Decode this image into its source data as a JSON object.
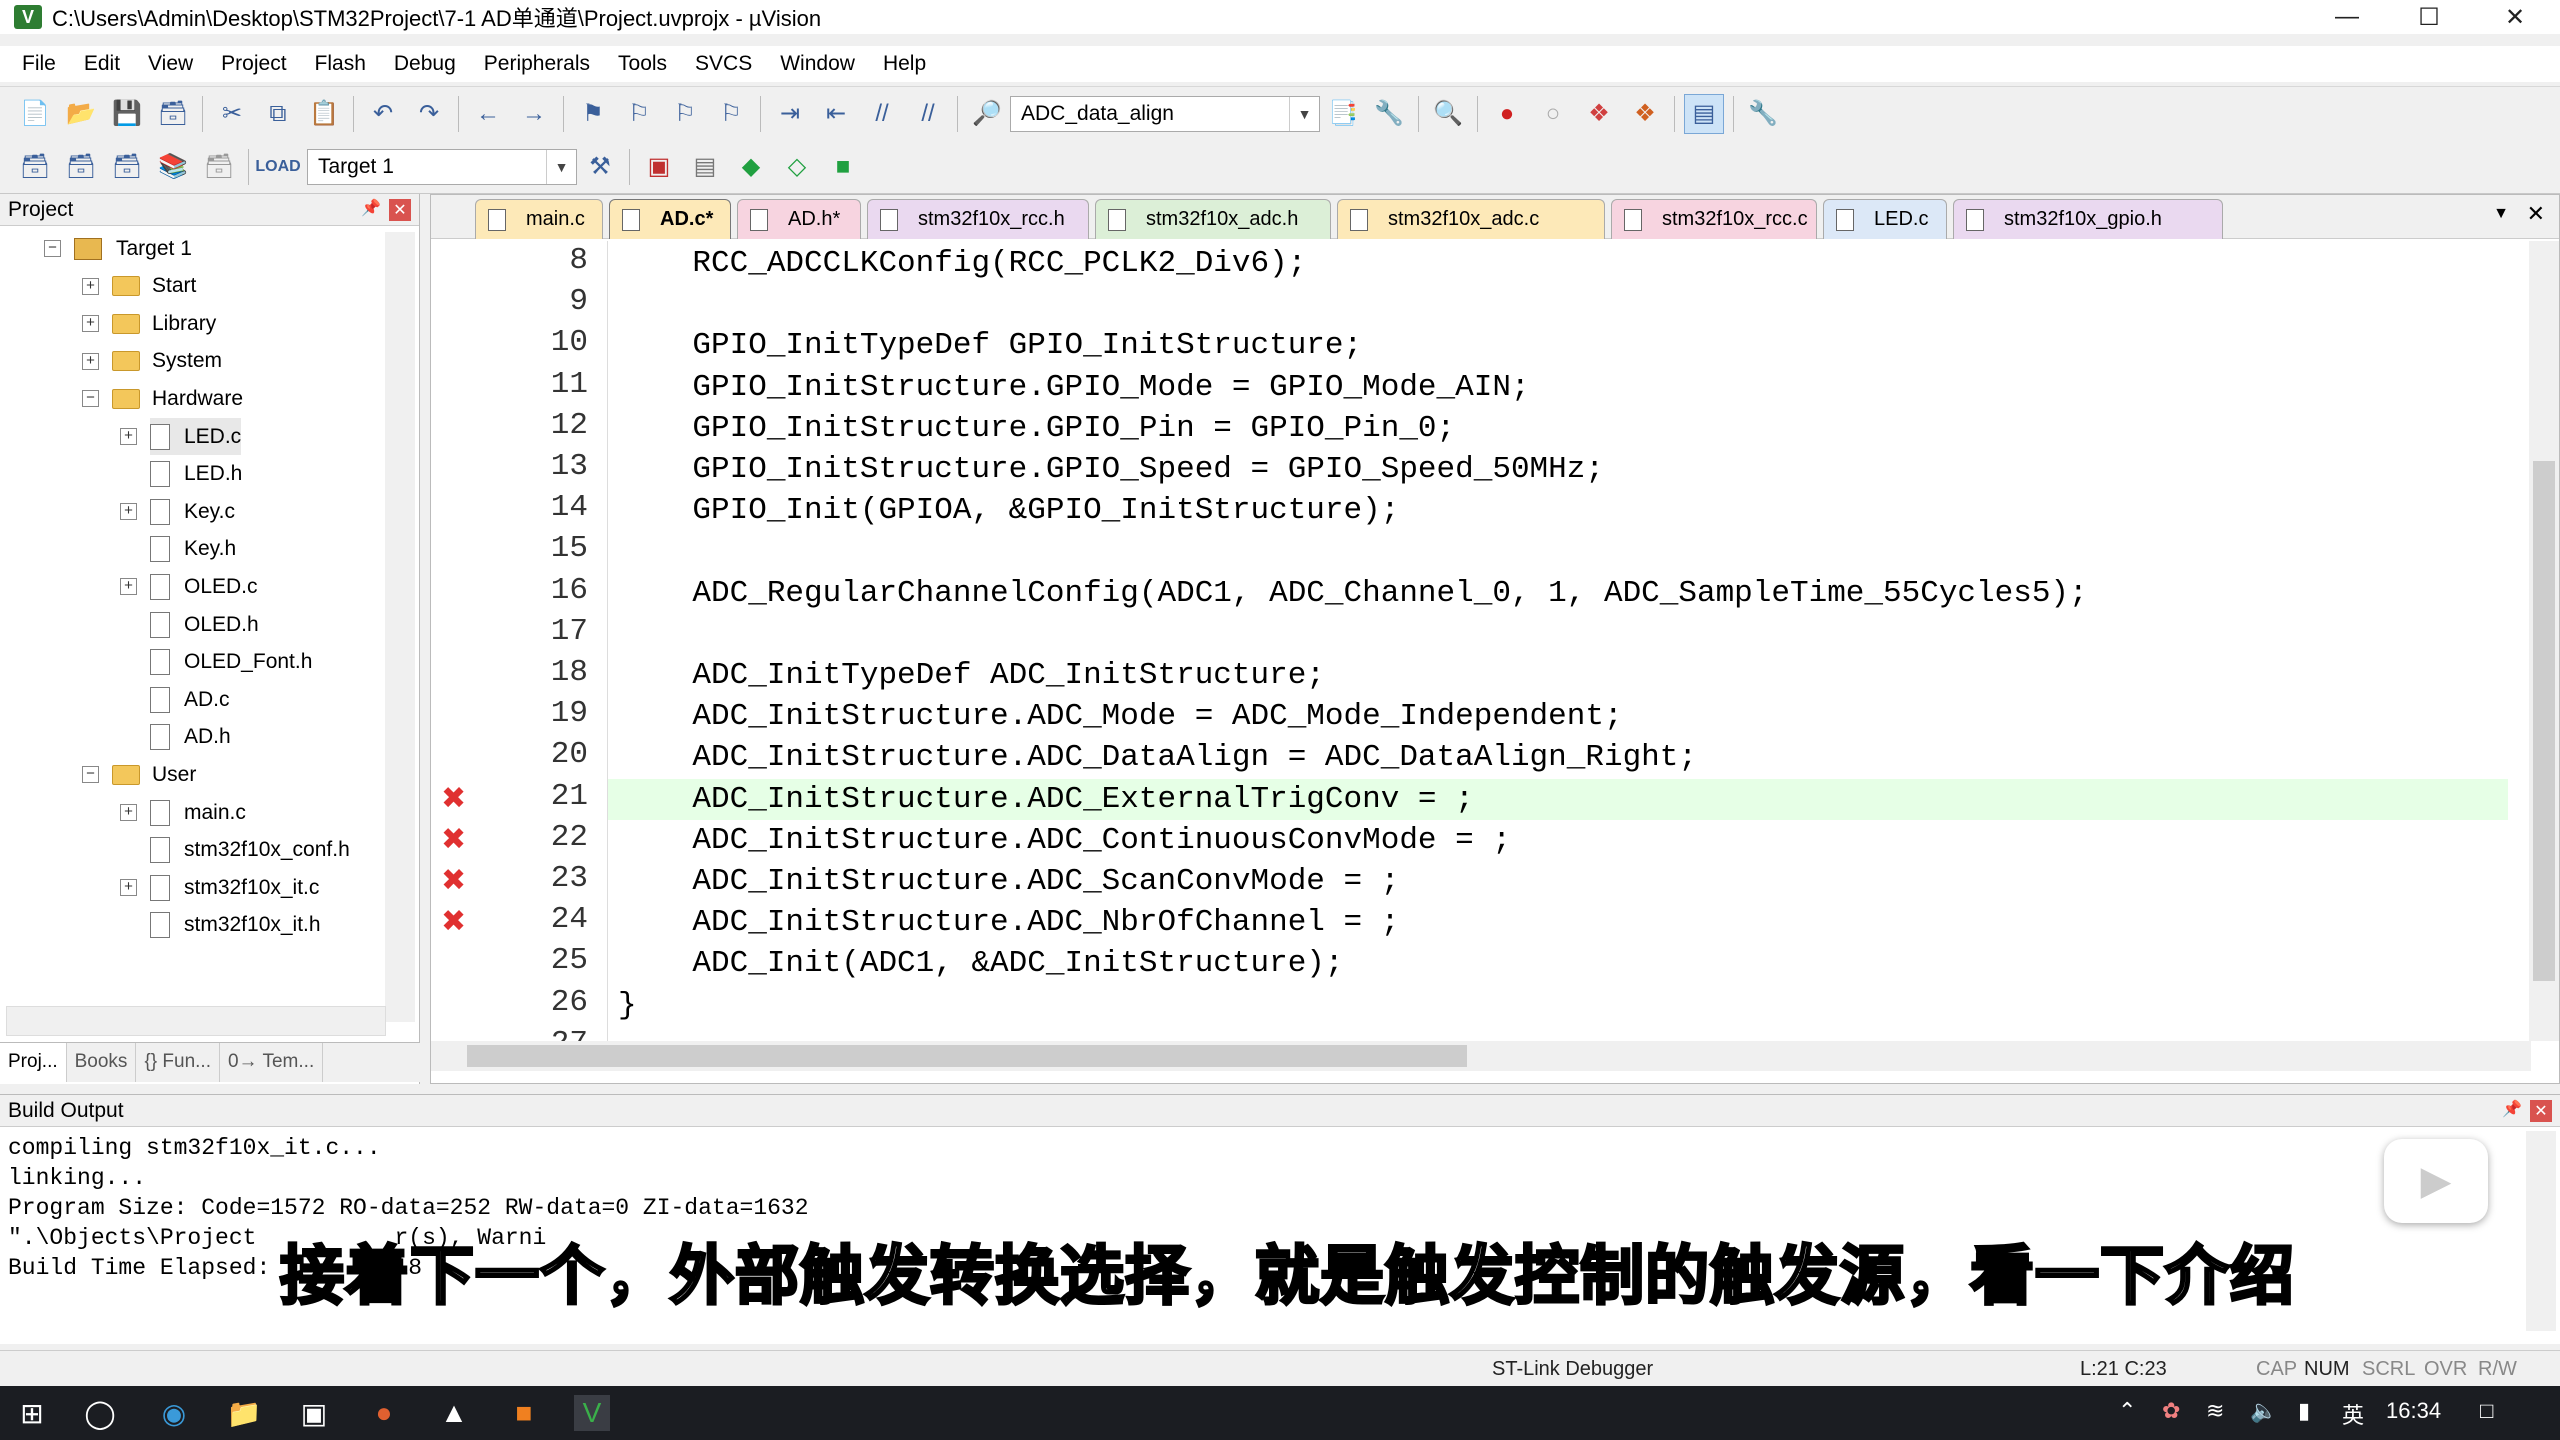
{
  "window": {
    "title": "C:\\Users\\Admin\\Desktop\\STM32Project\\7-1 AD单通道\\Project.uvprojx - µVision",
    "app_icon_letter": "V"
  },
  "menu": [
    "File",
    "Edit",
    "View",
    "Project",
    "Flash",
    "Debug",
    "Peripherals",
    "Tools",
    "SVCS",
    "Window",
    "Help"
  ],
  "toolbar1": {
    "find_combo": "ADC_data_align"
  },
  "toolbar2": {
    "target_combo": "Target 1"
  },
  "project_panel": {
    "title": "Project",
    "tree": [
      {
        "label": "Target 1",
        "level": 0,
        "kind": "target",
        "expander": "−"
      },
      {
        "label": "Start",
        "level": 1,
        "kind": "folder",
        "expander": "+"
      },
      {
        "label": "Library",
        "level": 1,
        "kind": "folder",
        "expander": "+"
      },
      {
        "label": "System",
        "level": 1,
        "kind": "folder",
        "expander": "+"
      },
      {
        "label": "Hardware",
        "level": 1,
        "kind": "folder",
        "expander": "−"
      },
      {
        "label": "LED.c",
        "level": 2,
        "kind": "file",
        "expander": "+"
      },
      {
        "label": "LED.h",
        "level": 2,
        "kind": "file",
        "expander": ""
      },
      {
        "label": "Key.c",
        "level": 2,
        "kind": "file",
        "expander": "+"
      },
      {
        "label": "Key.h",
        "level": 2,
        "kind": "file",
        "expander": ""
      },
      {
        "label": "OLED.c",
        "level": 2,
        "kind": "file",
        "expander": "+"
      },
      {
        "label": "OLED.h",
        "level": 2,
        "kind": "file",
        "expander": ""
      },
      {
        "label": "OLED_Font.h",
        "level": 2,
        "kind": "file",
        "expander": ""
      },
      {
        "label": "AD.c",
        "level": 2,
        "kind": "file",
        "expander": ""
      },
      {
        "label": "AD.h",
        "level": 2,
        "kind": "file",
        "expander": ""
      },
      {
        "label": "User",
        "level": 1,
        "kind": "folder",
        "expander": "−"
      },
      {
        "label": "main.c",
        "level": 2,
        "kind": "file",
        "expander": "+"
      },
      {
        "label": "stm32f10x_conf.h",
        "level": 2,
        "kind": "file",
        "expander": ""
      },
      {
        "label": "stm32f10x_it.c",
        "level": 2,
        "kind": "file",
        "expander": "+"
      },
      {
        "label": "stm32f10x_it.h",
        "level": 2,
        "kind": "file",
        "expander": ""
      }
    ],
    "tabs": [
      "Proj...",
      "Books",
      "{} Fun...",
      "0→ Tem..."
    ]
  },
  "editor": {
    "tabs": [
      {
        "label": "main.c",
        "color": "#fde9b8",
        "active": false
      },
      {
        "label": "AD.c*",
        "color": "#fde9b8",
        "active": true
      },
      {
        "label": "AD.h*",
        "color": "#f7d4e0",
        "active": false
      },
      {
        "label": "stm32f10x_rcc.h",
        "color": "#ead9f0",
        "active": false
      },
      {
        "label": "stm32f10x_adc.h",
        "color": "#dcefd7",
        "active": false
      },
      {
        "label": "stm32f10x_adc.c",
        "color": "#fde9b8",
        "active": false
      },
      {
        "label": "stm32f10x_rcc.c",
        "color": "#f7d4e0",
        "active": false
      },
      {
        "label": "LED.c",
        "color": "#dce8f7",
        "active": false
      },
      {
        "label": "stm32f10x_gpio.h",
        "color": "#ead9f0",
        "active": false
      }
    ],
    "lines": [
      {
        "n": "8",
        "text": "    RCC_ADCCLKConfig(RCC_PCLK2_Div6);",
        "error": false
      },
      {
        "n": "9",
        "text": "",
        "error": false
      },
      {
        "n": "10",
        "text": "    GPIO_InitTypeDef GPIO_InitStructure;",
        "error": false
      },
      {
        "n": "11",
        "text": "    GPIO_InitStructure.GPIO_Mode = GPIO_Mode_AIN;",
        "error": false
      },
      {
        "n": "12",
        "text": "    GPIO_InitStructure.GPIO_Pin = GPIO_Pin_0;",
        "error": false
      },
      {
        "n": "13",
        "text": "    GPIO_InitStructure.GPIO_Speed = GPIO_Speed_50MHz;",
        "error": false
      },
      {
        "n": "14",
        "text": "    GPIO_Init(GPIOA, &GPIO_InitStructure);",
        "error": false
      },
      {
        "n": "15",
        "text": "",
        "error": false
      },
      {
        "n": "16",
        "text": "    ADC_RegularChannelConfig(ADC1, ADC_Channel_0, 1, ADC_SampleTime_55Cycles5);",
        "error": false
      },
      {
        "n": "17",
        "text": "",
        "error": false
      },
      {
        "n": "18",
        "text": "    ADC_InitTypeDef ADC_InitStructure;",
        "error": false
      },
      {
        "n": "19",
        "text": "    ADC_InitStructure.ADC_Mode = ADC_Mode_Independent;",
        "error": false
      },
      {
        "n": "20",
        "text": "    ADC_InitStructure.ADC_DataAlign = ADC_DataAlign_Right;",
        "error": false
      },
      {
        "n": "21",
        "text": "    ADC_InitStructure.ADC_ExternalTrigConv = ;",
        "error": true
      },
      {
        "n": "22",
        "text": "    ADC_InitStructure.ADC_ContinuousConvMode = ;",
        "error": true
      },
      {
        "n": "23",
        "text": "    ADC_InitStructure.ADC_ScanConvMode = ;",
        "error": true
      },
      {
        "n": "24",
        "text": "    ADC_InitStructure.ADC_NbrOfChannel = ;",
        "error": true
      },
      {
        "n": "25",
        "text": "    ADC_Init(ADC1, &ADC_InitStructure);",
        "error": false
      },
      {
        "n": "26",
        "text": "}",
        "error": false
      },
      {
        "n": "27",
        "text": "",
        "error": false
      }
    ],
    "current_line": "21"
  },
  "build_output": {
    "title": "Build Output",
    "lines": [
      "compiling stm32f10x_it.c...",
      "linking...",
      "Program Size: Code=1572 RO-data=252 RW-data=0 ZI-data=1632",
      "\".\\Objects\\Project          r(s), Warni",
      "Build Time Elapsed:         18"
    ],
    "subtitle": "接着下一个，外部触发转换选择，就是触发控制的触发源，看一下介绍"
  },
  "statusbar": {
    "debugger": "ST-Link Debugger",
    "position": "L:21 C:23",
    "indicators": [
      "CAP",
      "NUM",
      "SCRL",
      "OVR",
      "R/W"
    ]
  },
  "taskbar": {
    "time": "16:34",
    "ime": "英"
  }
}
